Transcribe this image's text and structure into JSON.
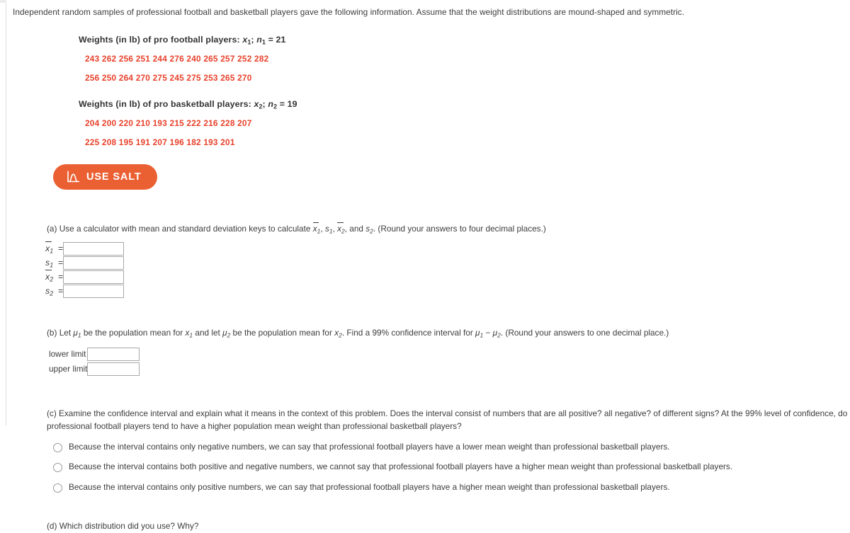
{
  "problem": {
    "intro": "Independent random samples of professional football and basketball players gave the following information. Assume that the weight distributions are mound-shaped and symmetric."
  },
  "football": {
    "title_prefix": "Weights (in lb) of pro football players: ",
    "title_var": "x",
    "title_var_sub": "1",
    "title_sep": "; ",
    "title_n": "n",
    "title_n_sub": "1",
    "title_eq": " = 21",
    "row1": "243  262  256  251  244  276  240  265  257  252  282",
    "row2": "256  250  264  270  275  245  275  253  265  270",
    "values": [
      243,
      262,
      256,
      251,
      244,
      276,
      240,
      265,
      257,
      252,
      282,
      256,
      250,
      264,
      270,
      275,
      245,
      275,
      253,
      265,
      270
    ],
    "n": 21
  },
  "basketball": {
    "title_prefix": "Weights (in lb) of pro basketball players: ",
    "title_var": "x",
    "title_var_sub": "2",
    "title_sep": "; ",
    "title_n": "n",
    "title_n_sub": "2",
    "title_eq": " = 19",
    "row1": "204  200  220  210  193  215  222  216  228  207",
    "row2": "225  208  195  191  207  196  182  193  201",
    "values": [
      204,
      200,
      220,
      210,
      193,
      215,
      222,
      216,
      228,
      207,
      225,
      208,
      195,
      191,
      207,
      196,
      182,
      193,
      201
    ],
    "n": 19
  },
  "salt": {
    "label": "USE SALT",
    "icon": "normal-curve-icon",
    "color": "#ea6033"
  },
  "part_a": {
    "text_1": "(a) Use a calculator with mean and standard deviation keys to calculate ",
    "text_2": ", ",
    "text_3": ", ",
    "text_4": ", and ",
    "text_5": ". (Round your answers to four decimal places.)",
    "rows": [
      {
        "var": "x",
        "sub": "1",
        "bar": true,
        "value": "",
        "eq": "="
      },
      {
        "var": "s",
        "sub": "1",
        "bar": false,
        "value": "",
        "eq": "="
      },
      {
        "var": "x",
        "sub": "2",
        "bar": true,
        "value": "",
        "eq": "="
      },
      {
        "var": "s",
        "sub": "2",
        "bar": false,
        "value": "",
        "eq": "="
      }
    ]
  },
  "part_b": {
    "t1": "(b) Let ",
    "mu": "μ",
    "s1": "1",
    "t2": " be the population mean for ",
    "x": "x",
    "t3": " and let ",
    "s2": "2",
    "t4": " be the population mean for ",
    "t5": ". Find a 99% confidence interval for ",
    "minus": " − ",
    "t6": ". (Round your answers to one decimal place.)",
    "lower_label": "lower limit",
    "upper_label": "upper limit",
    "lower_value": "",
    "upper_value": "",
    "confidence_level": "99%"
  },
  "part_c": {
    "text": "(c) Examine the confidence interval and explain what it means in the context of this problem. Does the interval consist of numbers that are all positive? all negative? of different signs? At the 99% level of confidence, do professional football players tend to have a higher population mean weight than professional basketball players?",
    "options": [
      "Because the interval contains only negative numbers, we can say that professional football players have a lower mean weight than professional basketball players.",
      "Because the interval contains both positive and negative numbers, we cannot say that professional football players have a higher mean weight than professional basketball players.",
      "Because the interval contains only positive numbers, we can say that professional football players have a higher mean weight than professional basketball players."
    ],
    "selected": null
  },
  "part_d": {
    "text": "(d) Which distribution did you use? Why?"
  }
}
